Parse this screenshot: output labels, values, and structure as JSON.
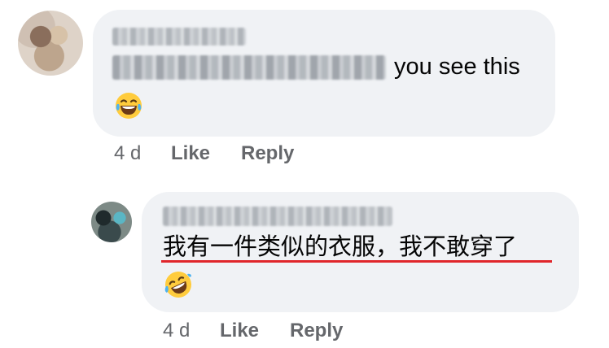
{
  "comment1": {
    "text": "you see this",
    "emoji": "grinning-squinting-tears-emoji",
    "timestamp": "4 d",
    "like_label": "Like",
    "reply_label": "Reply"
  },
  "comment2": {
    "text": "我有一件类似的衣服，我不敢穿了",
    "emoji": "rolling-on-floor-laughing-emoji",
    "timestamp": "4 d",
    "like_label": "Like",
    "reply_label": "Reply"
  },
  "colors": {
    "bubble": "#f0f2f5",
    "meta_text": "#65676b",
    "annotation_underline": "#e0262b"
  }
}
